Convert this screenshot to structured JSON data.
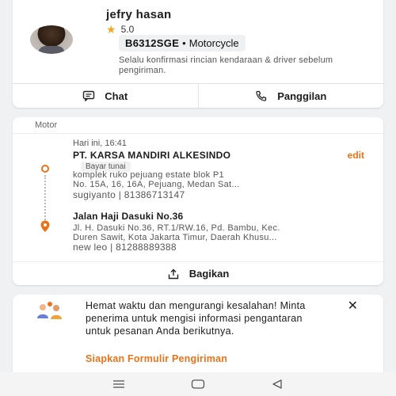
{
  "driver": {
    "name": "jefry hasan",
    "rating": "5.0",
    "plate": "B6312SGE",
    "separator": "•",
    "vehicle_type": "Motorcycle",
    "note": "Selalu konfirmasi rincian kendaraan & driver sebelum pengiriman."
  },
  "actions": {
    "chat_label": "Chat",
    "call_label": "Panggilan"
  },
  "order": {
    "service": "Motor",
    "time": "Hari ini, 16:41",
    "edit_label": "edit",
    "pickup": {
      "name": "PT. KARSA MANDIRI ALKESINDO",
      "payment": "Bayar tunai",
      "address_line1": "komplek ruko pejuang estate blok P1",
      "address_line2": "No. 15A, 16, 16A, Pejuang, Medan Sat...",
      "contact": "sugiyanto | 81386713147"
    },
    "dropoff": {
      "name": "Jalan Haji Dasuki No.36",
      "address_line1": "Jl. H. Dasuki No.36, RT.1/RW.16, Pd. Bambu, Kec.",
      "address_line2": "Duren Sawit, Kota Jakarta Timur, Daerah Khusu...",
      "contact": "new leo | 81288889388"
    },
    "share_label": "Bagikan"
  },
  "promo": {
    "text": "Hemat waktu dan mengurangi kesalahan! Minta penerima untuk mengisi informasi pengantaran untuk pesanan Anda berikutnya.",
    "close_glyph": "✕",
    "link_label": "Siapkan Formulir Pengiriman"
  },
  "colors": {
    "accent": "#e8731a",
    "star": "#f5a623",
    "background": "#f0f1f3"
  }
}
